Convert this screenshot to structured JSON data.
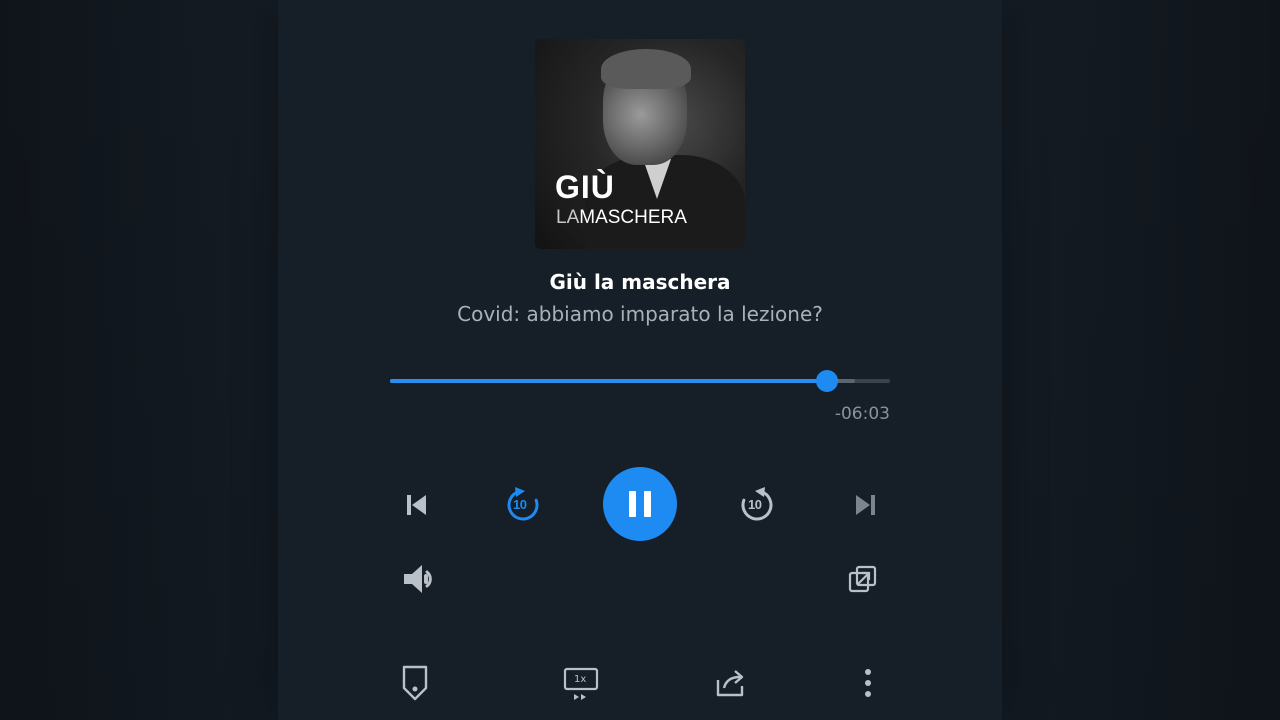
{
  "artwork": {
    "title_line1": "GIÙ",
    "title_line2_prefix": "LA",
    "title_line2_rest": "MASCHERA"
  },
  "track": {
    "title": "Giù la maschera",
    "subtitle": "Covid: abbiamo imparato la lezione?"
  },
  "progress": {
    "played_fraction": 0.874,
    "buffered_fraction": 0.93,
    "time_remaining": "-06:03"
  },
  "controls": {
    "skip_back_seconds": "10",
    "skip_forward_seconds": "10",
    "speed_label": "1x"
  },
  "colors": {
    "accent": "#1e8bf2",
    "background": "#161e27",
    "icon": "#b9c0c8",
    "icon_dim": "#8d959e"
  },
  "icons": {
    "previous": "skip-previous-icon",
    "rewind": "rewind-10-icon",
    "play_pause": "pause-icon",
    "forward": "forward-10-icon",
    "next": "skip-next-icon",
    "volume": "volume-icon",
    "external": "open-external-icon",
    "bookmark": "bookmark-icon",
    "speed": "playback-speed-icon",
    "share": "share-icon",
    "more": "more-vertical-icon"
  }
}
